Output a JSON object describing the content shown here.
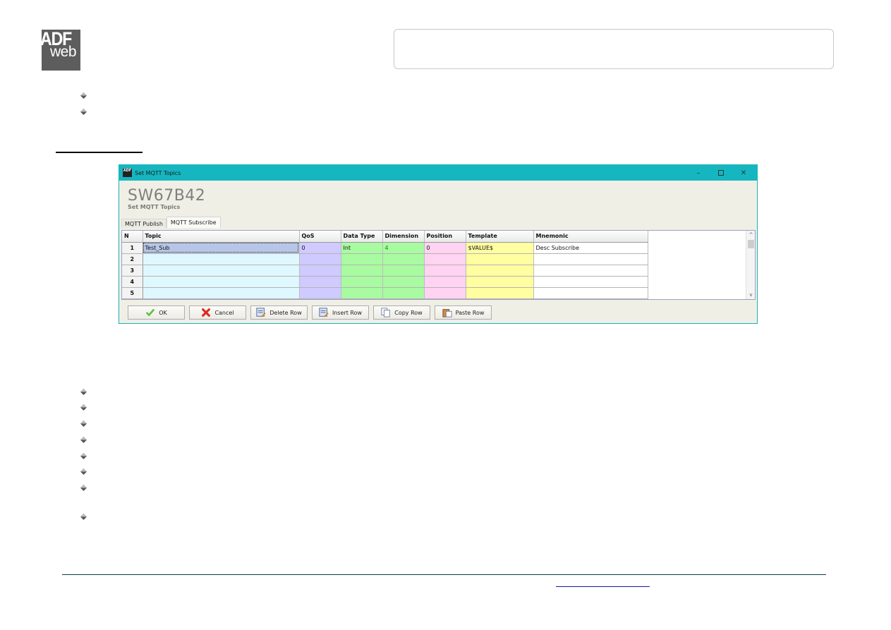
{
  "logo": {
    "line1": "ADF",
    "line2": "web"
  },
  "dialog": {
    "window_title": "Set MQTT Topics",
    "app_icon_text": "ADF",
    "product_code": "SW67B42",
    "subtitle": "Set MQTT Topics",
    "controls": {
      "minimize": "–",
      "close": "✕"
    },
    "tabs": [
      {
        "label": "MQTT Publish",
        "active": false
      },
      {
        "label": "MQTT Subscribe",
        "active": true
      }
    ],
    "grid": {
      "columns": [
        "N",
        "Topic",
        "QoS",
        "Data Type",
        "Dimension",
        "Position",
        "Template",
        "Mnemonic"
      ],
      "rows": [
        {
          "n": "1",
          "topic": "Test_Sub",
          "qos": "0",
          "data_type": "Int",
          "dimension": "4",
          "position": "0",
          "template": "$VALUE$",
          "mnemonic": "Desc Subscribe"
        },
        {
          "n": "2",
          "topic": "",
          "qos": "",
          "data_type": "",
          "dimension": "",
          "position": "",
          "template": "",
          "mnemonic": ""
        },
        {
          "n": "3",
          "topic": "",
          "qos": "",
          "data_type": "",
          "dimension": "",
          "position": "",
          "template": "",
          "mnemonic": ""
        },
        {
          "n": "4",
          "topic": "",
          "qos": "",
          "data_type": "",
          "dimension": "",
          "position": "",
          "template": "",
          "mnemonic": ""
        },
        {
          "n": "5",
          "topic": "",
          "qos": "",
          "data_type": "",
          "dimension": "",
          "position": "",
          "template": "",
          "mnemonic": ""
        }
      ]
    },
    "scrollbar": {
      "up": "^",
      "down": "v"
    },
    "buttons": {
      "ok": "OK",
      "cancel": "Cancel",
      "delete_row": "Delete Row",
      "insert_row": "Insert Row",
      "copy_row": "Copy Row",
      "paste_row": "Paste Row"
    }
  },
  "colors": {
    "titlebar": "#16b6c0",
    "topic_col": "#dff8ff",
    "qos_col": "#cfcaff",
    "datatype_col": "#a8fba0",
    "position_col": "#ffd3f1",
    "template_col": "#fffea0"
  }
}
